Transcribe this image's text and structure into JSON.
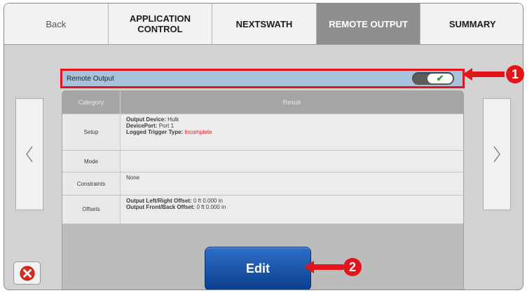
{
  "tabs": {
    "back": "Back",
    "application_control": "APPLICATION CONTROL",
    "nextswath": "NEXTSWATH",
    "remote_output": "REMOTE OUTPUT",
    "summary": "SUMMARY",
    "active": "REMOTE OUTPUT"
  },
  "remote_output": {
    "label": "Remote Output",
    "toggle_on": true
  },
  "table": {
    "headers": {
      "category": "Category",
      "result": "Result"
    },
    "rows": {
      "setup": {
        "category": "Setup",
        "output_device_label": "Output Device:",
        "output_device_value": "Hulk",
        "device_port_label": "DevicePort:",
        "device_port_value": "Port 1",
        "trigger_label": "Logged Trigger Type:",
        "trigger_value": "Incomplete"
      },
      "mode": {
        "category": "Mode",
        "result": ""
      },
      "constraints": {
        "category": "Constraints",
        "result": "None"
      },
      "offsets": {
        "category": "Offsets",
        "left_right_label": "Output Left/Right Offset:",
        "left_right_value": "0 ft 0.000 in",
        "front_back_label": "Output Front/Back Offset:",
        "front_back_value": "0 ft 0.000 in"
      }
    }
  },
  "buttons": {
    "edit": "Edit"
  },
  "callouts": {
    "one": "1",
    "two": "2"
  },
  "colors": {
    "accent_red": "#e3141a",
    "edit_blue": "#0a3e8c",
    "toggle_check": "#2e9a2a",
    "bar_blue": "#a7c3dc"
  }
}
